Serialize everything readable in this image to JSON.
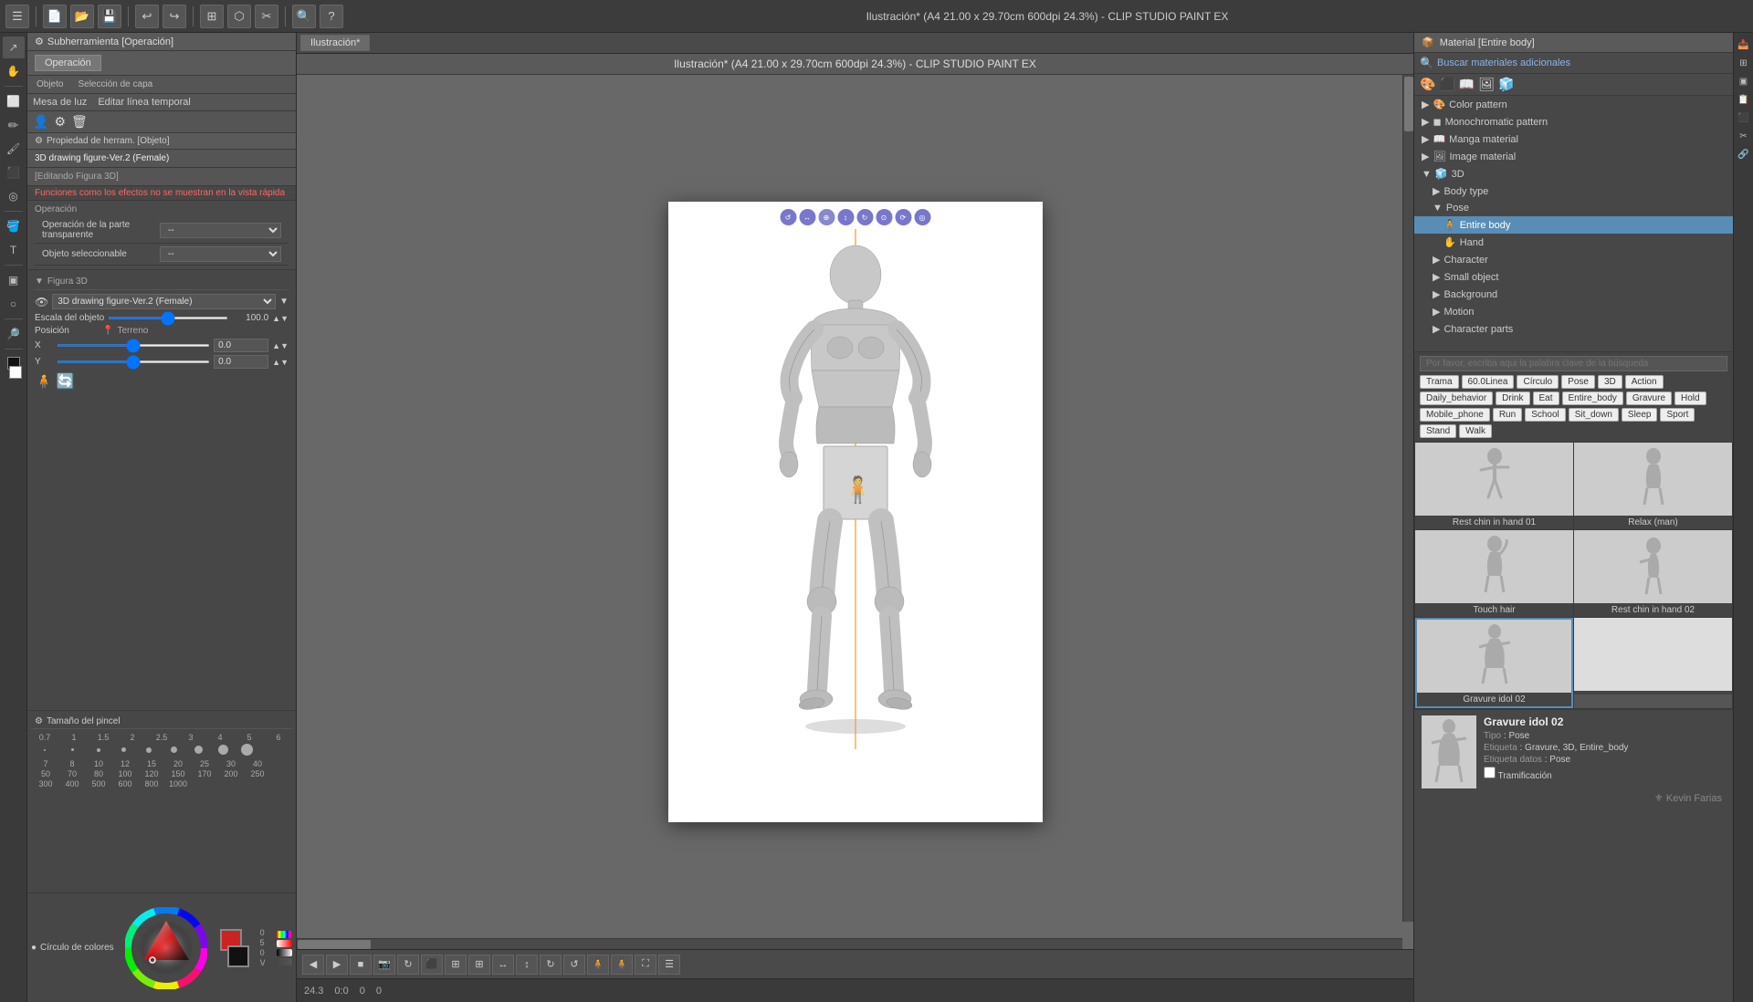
{
  "app": {
    "title": "Ilustración* (A4 21.00 x 29.70cm 600dpi 24.3%) - CLIP STUDIO PAINT EX",
    "tab": "Ilustración*"
  },
  "toolbar": {
    "buttons": [
      "⊞",
      "▶",
      "◀",
      "💾",
      "📁",
      "📂",
      "↩",
      "↪",
      "✂",
      "📋",
      "🔍",
      "⚙",
      "?"
    ]
  },
  "left_tools": {
    "tools": [
      "↗",
      "✋",
      "🔲",
      "✏",
      "✏",
      "🖌",
      "🖊",
      "🖌",
      "▣",
      "T",
      "G",
      "✂",
      "🪣",
      "⬛",
      "⬡",
      "🔎"
    ]
  },
  "operation_panel": {
    "title": "Subherramienta [Operación]",
    "tab": "Operación",
    "sub_tools": {
      "objeto": "Objeto",
      "seleccion": "Selección de capa",
      "mesa": "Mesa de luz",
      "editar": "Editar línea temporal"
    }
  },
  "prop_panel": {
    "title": "Propiedad de herram. [Objeto]",
    "figure_name": "3D drawing figure-Ver.2 (Female)",
    "editing_label": "[Editando Figura 3D]",
    "warning": "Funciones como los efectos no se muestran en la vista rápida",
    "operation_label": "Operación",
    "transparent_op": "Operación de la parte transparente",
    "selectable": "Objeto seleccionable",
    "figura3d": "Figura 3D",
    "figure_model": "3D drawing figure-Ver.2 (Female)",
    "scale_label": "Escala del objeto",
    "scale_value": "100.0",
    "position_label": "Posición",
    "terrain_label": "Terreno",
    "x_label": "X",
    "x_value": "0.0",
    "y_label": "Y",
    "y_value": "0.0"
  },
  "brush_panel": {
    "title": "Tamaño del pincel",
    "sizes_row1": [
      "0.7",
      "1",
      "1.5",
      "2",
      "2.5",
      "3",
      "4",
      "5",
      "6"
    ],
    "sizes_row2": [
      "7",
      "8",
      "10",
      "12",
      "15",
      "20",
      "25",
      "30"
    ],
    "sizes_row3": [
      "40",
      "50",
      "70",
      "80",
      "100",
      "120",
      "150",
      "170"
    ],
    "sizes_row4": [
      "200",
      "250",
      "300",
      "400",
      "500",
      "600",
      "800",
      "1000"
    ]
  },
  "color_panel": {
    "title": "Círculo de colores"
  },
  "canvas": {
    "zoom": "24.3",
    "coords": "0:0",
    "position": "0:0"
  },
  "material_panel": {
    "title": "Material [Entire body]",
    "search_btn": "Buscar materiales adicionales",
    "categories": [
      {
        "id": "color_pattern",
        "label": "Color pattern",
        "level": 0,
        "expanded": false
      },
      {
        "id": "mono_pattern",
        "label": "Monochromatic pattern",
        "level": 0,
        "expanded": false
      },
      {
        "id": "manga_material",
        "label": "Manga material",
        "level": 0,
        "expanded": false
      },
      {
        "id": "image_material",
        "label": "Image material",
        "level": 0,
        "expanded": false
      },
      {
        "id": "3d",
        "label": "3D",
        "level": 0,
        "expanded": true
      },
      {
        "id": "body_type",
        "label": "Body type",
        "level": 1,
        "expanded": false
      },
      {
        "id": "pose",
        "label": "Pose",
        "level": 1,
        "expanded": true
      },
      {
        "id": "entire_body",
        "label": "Entire body",
        "level": 2,
        "selected": true
      },
      {
        "id": "hand",
        "label": "Hand",
        "level": 2
      },
      {
        "id": "character",
        "label": "Character",
        "level": 1
      },
      {
        "id": "small_object",
        "label": "Small object",
        "level": 1
      },
      {
        "id": "background",
        "label": "Background",
        "level": 1
      },
      {
        "id": "motion",
        "label": "Motion",
        "level": 1
      },
      {
        "id": "character_parts",
        "label": "Character parts",
        "level": 1
      }
    ]
  },
  "keyword_search": {
    "placeholder": "Por favor, escriba aqui la palabra clave de la búsqueda",
    "tags": [
      "Trama",
      "60.0Linea",
      "Círculo",
      "Pose",
      "3D",
      "Action",
      "Daily_behavior",
      "Drink",
      "Eat",
      "Entire_body",
      "Gravure",
      "Hold",
      "Mobile_phone",
      "Run",
      "School",
      "Sit_down",
      "Sleep",
      "Sport",
      "Stand",
      "Walk"
    ]
  },
  "thumbnails": [
    {
      "label": "Rest chin in hand 01",
      "id": "thumb1"
    },
    {
      "label": "Relax (man)",
      "id": "thumb2"
    },
    {
      "label": "Touch hair",
      "id": "thumb3"
    },
    {
      "label": "Rest chin in hand 02",
      "id": "thumb4"
    },
    {
      "label": "Gravure idol 02",
      "id": "thumb5",
      "selected": true
    },
    {
      "label": "",
      "id": "thumb6"
    }
  ],
  "info": {
    "title": "Gravure idol 02",
    "type_label": "Tipo",
    "type_value": "Pose",
    "tag_label": "Etiqueta",
    "tag_value": "Gravure, 3D, Entire_body",
    "data_tag_label": "Etiqueta datos",
    "data_tag_value": "Pose",
    "tramificacion": "Tramificación"
  },
  "watermark": "Kevin Farias"
}
